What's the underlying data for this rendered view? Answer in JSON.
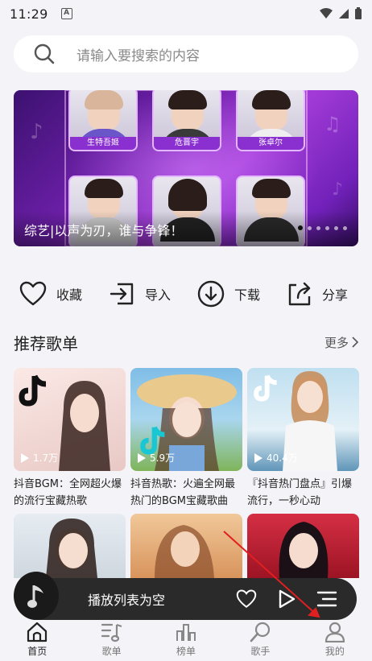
{
  "status": {
    "time": "11:29",
    "badge": "A"
  },
  "search": {
    "placeholder": "请输入要搜索的内容"
  },
  "banner": {
    "caption": "综艺|以声为刃，谁与争锋！",
    "artists": [
      "生特吾姬",
      "危晋宇",
      "张卓尔"
    ],
    "dot_count": 6,
    "active_dot": 0
  },
  "actions": [
    {
      "label": "收藏",
      "icon": "heart-icon"
    },
    {
      "label": "导入",
      "icon": "import-icon"
    },
    {
      "label": "下载",
      "icon": "download-icon"
    },
    {
      "label": "分享",
      "icon": "share-icon"
    }
  ],
  "recommend": {
    "title": "推荐歌单",
    "more": "更多"
  },
  "playlists": [
    {
      "plays": "1.7万",
      "title": "抖音BGM：全网超火爆的流行宝藏热歌",
      "bg": "#f1d9d6"
    },
    {
      "plays": "5.9万",
      "title": "抖音热歌：火遍全网最热门的BGM宝藏歌曲",
      "bg": "#8fc6e9"
    },
    {
      "plays": "40.4万",
      "title": "『抖音热门盘点』引爆流行，一秒心动",
      "bg": "#c9e3f0"
    }
  ],
  "playlists_row2": [
    {
      "bg": "#dfe6ee"
    },
    {
      "bg": "#e9b98f"
    },
    {
      "bg": "#c8253a"
    }
  ],
  "mini_player": {
    "text": "播放列表为空"
  },
  "tabs": [
    {
      "label": "首页",
      "icon": "home-icon",
      "active": true
    },
    {
      "label": "歌单",
      "icon": "music-list-icon",
      "active": false
    },
    {
      "label": "榜单",
      "icon": "chart-icon",
      "active": false
    },
    {
      "label": "歌手",
      "icon": "singer-icon",
      "active": false
    },
    {
      "label": "我的",
      "icon": "profile-icon",
      "active": false
    }
  ],
  "colors": {
    "background": "#f4f4f8",
    "banner_purple": "#8a2fd0",
    "player_bg": "#2a2a2a",
    "annotation_red": "#e02020"
  }
}
